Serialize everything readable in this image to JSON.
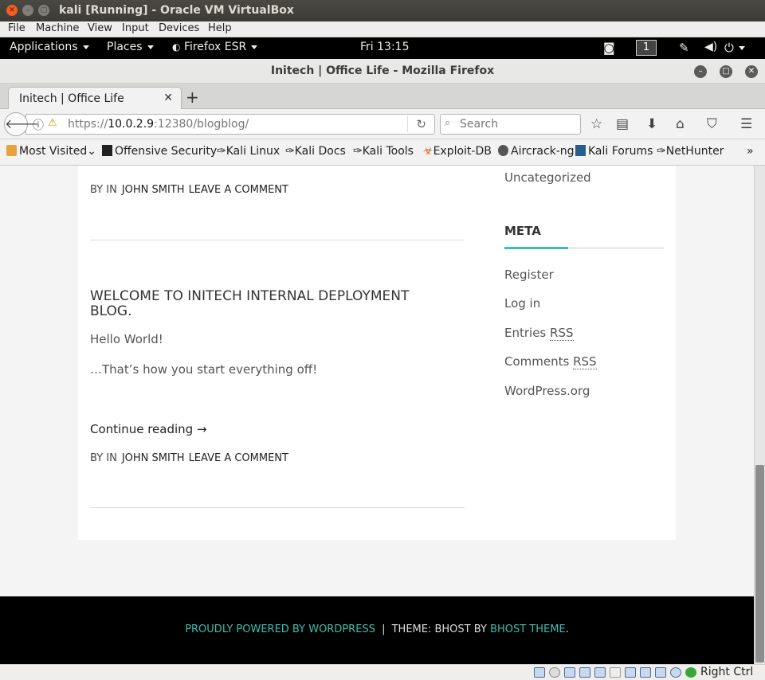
{
  "vbox": {
    "title": "kali [Running] - Oracle VM VirtualBox",
    "menu": [
      "File",
      "Machine",
      "View",
      "Input",
      "Devices",
      "Help"
    ],
    "host_key": "Right Ctrl"
  },
  "gnome": {
    "applications": "Applications",
    "places": "Places",
    "firefox": "Firefox ESR",
    "clock": "Fri 13:15",
    "workspace": "1"
  },
  "firefox": {
    "window_title": "Initech | Office Life - Mozilla Firefox",
    "tab_title": "Initech | Office Life",
    "url_prefix": "https://",
    "url_host": "10.0.2.9",
    "url_rest": ":12380/blogblog/",
    "search_placeholder": "Search",
    "bookmarks": [
      "Most Visited",
      "Offensive Security",
      "Kali Linux",
      "Kali Docs",
      "Kali Tools",
      "Exploit-DB",
      "Aircrack-ng",
      "Kali Forums",
      "NetHunter"
    ]
  },
  "page": {
    "meta1": {
      "by_in": "By In",
      "author": "John Smith",
      "comment": "Leave a comment"
    },
    "post": {
      "title": "Welcome to Initech Internal Deployment Blog.",
      "p1": "Hello World!",
      "p2": "…That’s how you start everything off!",
      "continue": "Continue reading →"
    },
    "meta2": {
      "by_in": "By In",
      "author": "John Smith",
      "comment": "Leave a comment"
    },
    "sidebar": {
      "uncategorized": "Uncategorized",
      "meta_heading": "META",
      "register": "Register",
      "login": "Log in",
      "entries": "Entries",
      "comments": "Comments",
      "rss": "RSS",
      "wordpress": "WordPress.org"
    },
    "footer": {
      "powered": "Proudly powered by WordPress",
      "sep": "|",
      "theme_prefix": "Theme: BHost by",
      "theme_link": "BHost Theme",
      "period": "."
    }
  }
}
